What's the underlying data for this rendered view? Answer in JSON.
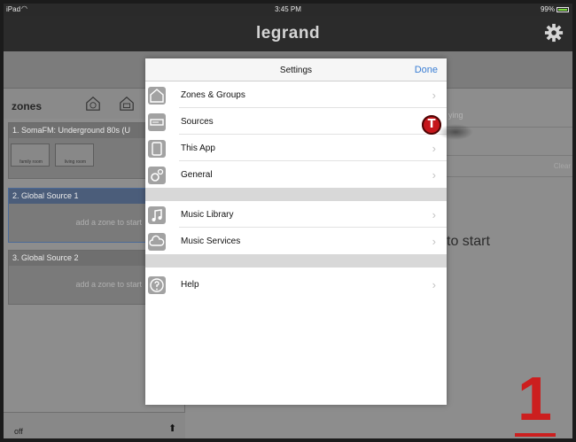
{
  "status": {
    "carrier": "iPad",
    "time": "3:45 PM",
    "battery": "99%"
  },
  "app": {
    "logo": "legrand"
  },
  "zones_panel": {
    "title": "zones",
    "sources": [
      {
        "name": "1. SomaFM: Underground 80s (U",
        "zones": [
          "family room",
          "living room"
        ]
      },
      {
        "name": "2. Global Source 1",
        "add_text": "add a zone to start"
      },
      {
        "name": "3. Global Source 2",
        "add_text": "add a zone to start"
      }
    ],
    "footer_status": "off"
  },
  "right_pane": {
    "header_text": "ying",
    "center_text": "to start",
    "row_text": "Clear"
  },
  "settings": {
    "title": "Settings",
    "done_label": "Done",
    "groups": [
      [
        {
          "label": "Zones & Groups",
          "icon": "house-icon"
        },
        {
          "label": "Sources",
          "icon": "sources-icon"
        },
        {
          "label": "This App",
          "icon": "tablet-icon"
        },
        {
          "label": "General",
          "icon": "gears-icon"
        }
      ],
      [
        {
          "label": "Music Library",
          "icon": "music-note-icon"
        },
        {
          "label": "Music Services",
          "icon": "cloud-icon"
        }
      ],
      [
        {
          "label": "Help",
          "icon": "help-icon"
        }
      ]
    ]
  },
  "overlay": {
    "touch_badge": "T",
    "step_number": "1",
    "accent_color": "#cc1f1f"
  }
}
